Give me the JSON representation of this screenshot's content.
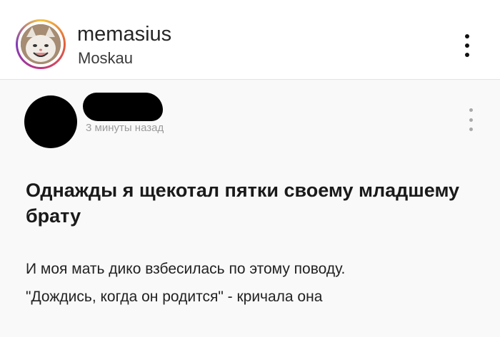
{
  "header": {
    "username": "memasius",
    "location": "Moskau"
  },
  "post": {
    "time": "3 минуты назад",
    "title": "Однажды я щекотал пятки своему младшему брату",
    "body_line1": "И моя мать дико взбесилась по этому поводу.",
    "body_line2": "\"Дождись, когда он родится\" - кричала она"
  },
  "icons": {
    "avatar": "cat-avatar",
    "header_more": "more-vertical-icon",
    "post_more": "more-vertical-icon"
  },
  "colors": {
    "ring": "#c1357f",
    "time": "#9b9b9b"
  }
}
